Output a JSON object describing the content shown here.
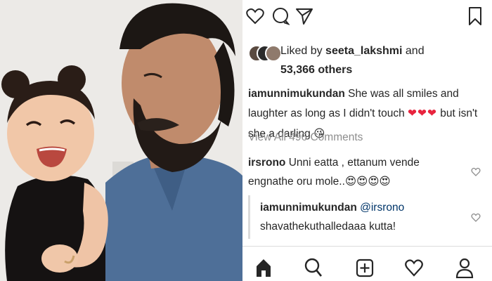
{
  "post": {
    "liked_by_prefix": "Liked by ",
    "liked_by_user": "seeta_lakshmi",
    "liked_by_and": " and",
    "likes_others": "53,366 others",
    "caption": {
      "username": "iamunnimukundan",
      "text": " She was all smiles and laughter as long as I didn't touch ",
      "hearts": "❤❤❤",
      "text2": " but isn't she a darling ",
      "emoji": "😘"
    },
    "view_all_comments": "View All 496 Comments",
    "comments": [
      {
        "username": "irsrono",
        "text": " Unni eatta , ettanum vende engnathe oru mole..",
        "emoji": "😍😍😍😍"
      }
    ],
    "replies": [
      {
        "username": "iamunnimukundan",
        "mention": "@irsrono",
        "text": " shavathekuthalledaaa kutta!"
      }
    ]
  },
  "icons": {
    "actions": [
      "heart-icon",
      "comment-icon",
      "share-icon",
      "bookmark-icon"
    ],
    "nav": [
      "home-icon",
      "search-icon",
      "add-icon",
      "activity-icon",
      "profile-icon"
    ]
  },
  "colors": {
    "text": "#262626",
    "muted": "#8e8e8e",
    "heart": "#e8243e",
    "separator": "#dbdbdb"
  }
}
